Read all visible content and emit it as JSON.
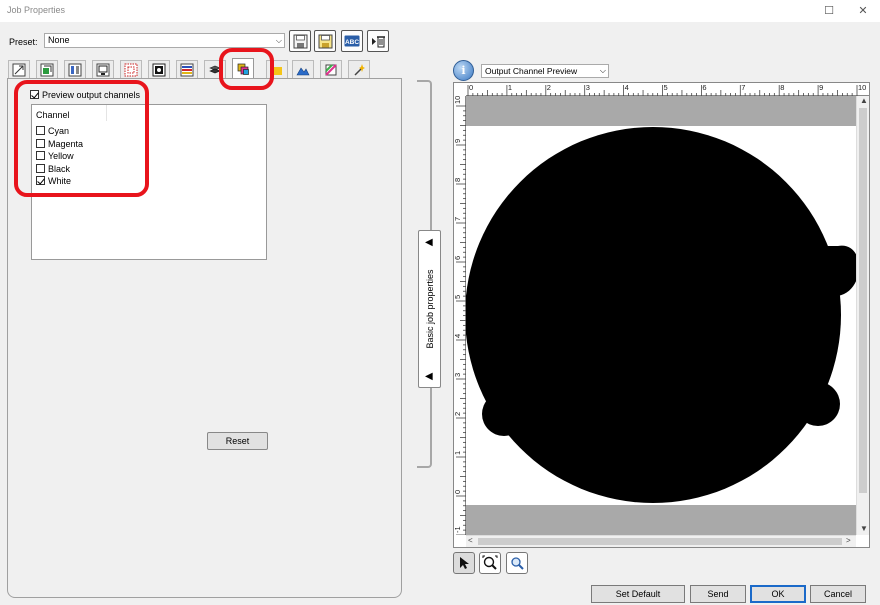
{
  "window": {
    "title": "Job Properties",
    "maximize_glyph": "☐",
    "close_glyph": "✕"
  },
  "preset": {
    "label": "Preset:",
    "value": "None",
    "buttons": [
      "save-icon",
      "save-as-icon",
      "rename-icon",
      "delete-icon"
    ],
    "rename_text": "ABC"
  },
  "tabs": {
    "active_index": 6,
    "icons": [
      "size-icon",
      "position-icon",
      "layout-icon",
      "tiling-icon",
      "crop-icon",
      "frame-icon",
      "color-icon",
      "layers-icon",
      "output-channels-icon",
      "white-channel-icon",
      "mountain-icon",
      "color-correction-icon",
      "effects-wand-icon"
    ]
  },
  "output_channels": {
    "preview_label": "Preview output channels",
    "preview_checked": true,
    "column_header": "Channel",
    "channels": [
      {
        "name": "Cyan",
        "checked": false
      },
      {
        "name": "Magenta",
        "checked": false
      },
      {
        "name": "Yellow",
        "checked": false
      },
      {
        "name": "Black",
        "checked": false
      },
      {
        "name": "White",
        "checked": true
      }
    ],
    "reset_label": "Reset"
  },
  "side_panel": {
    "label": "Basic job properties",
    "arrow_glyph": "◀"
  },
  "preview": {
    "info_glyph": "i",
    "view_mode": "Output Channel Preview",
    "ruler_h": [
      "0",
      "1",
      "2",
      "3",
      "4",
      "5",
      "6",
      "7",
      "8",
      "9",
      "10"
    ],
    "ruler_v": [
      "10",
      "9",
      "8",
      "7",
      "6",
      "5",
      "4",
      "3",
      "2",
      "1",
      "0",
      "-1"
    ],
    "scroll_glyphs": {
      "up": "▲",
      "down": "▼",
      "left": "<",
      "right": ">"
    }
  },
  "tools": [
    "select-arrow-icon",
    "zoom-tool-icon",
    "zoom-fit-icon"
  ],
  "footer": {
    "set_default": "Set Default",
    "send": "Send",
    "ok": "OK",
    "cancel": "Cancel"
  },
  "colors": {
    "highlight": "#e8141c",
    "accent": "#1b6ac9",
    "artwork": "#000000"
  }
}
